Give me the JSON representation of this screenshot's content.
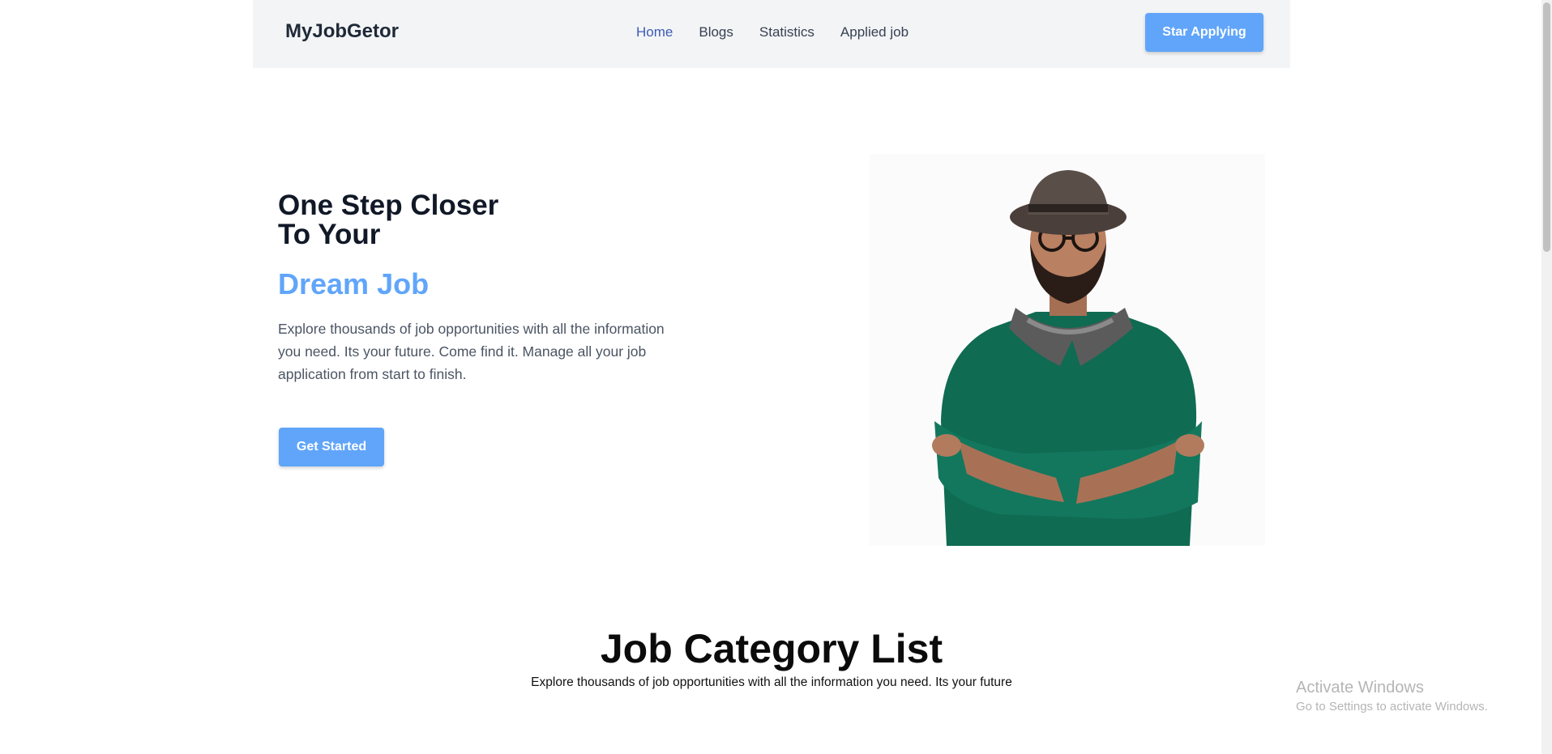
{
  "navbar": {
    "brand": "MyJobGetor",
    "links": [
      {
        "label": "Home",
        "active": true
      },
      {
        "label": "Blogs",
        "active": false
      },
      {
        "label": "Statistics",
        "active": false
      },
      {
        "label": "Applied job",
        "active": false
      }
    ],
    "cta_label": "Star Applying"
  },
  "hero": {
    "title_line1": "One Step Closer",
    "title_line2": "To Your",
    "highlight": "Dream Job",
    "description": "Explore thousands of job opportunities with all the information you need. Its your future. Come find it. Manage all your job application from start to finish.",
    "cta_label": "Get Started"
  },
  "categories": {
    "title": "Job Category List",
    "subtitle": "Explore thousands of job opportunities with all the information you need. Its your future"
  },
  "watermark": {
    "title": "Activate Windows",
    "subtitle": "Go to Settings to activate Windows."
  },
  "colors": {
    "accent": "#60a5fa",
    "active_link": "#3b5bb5",
    "navbar_bg": "#f3f4f6"
  }
}
